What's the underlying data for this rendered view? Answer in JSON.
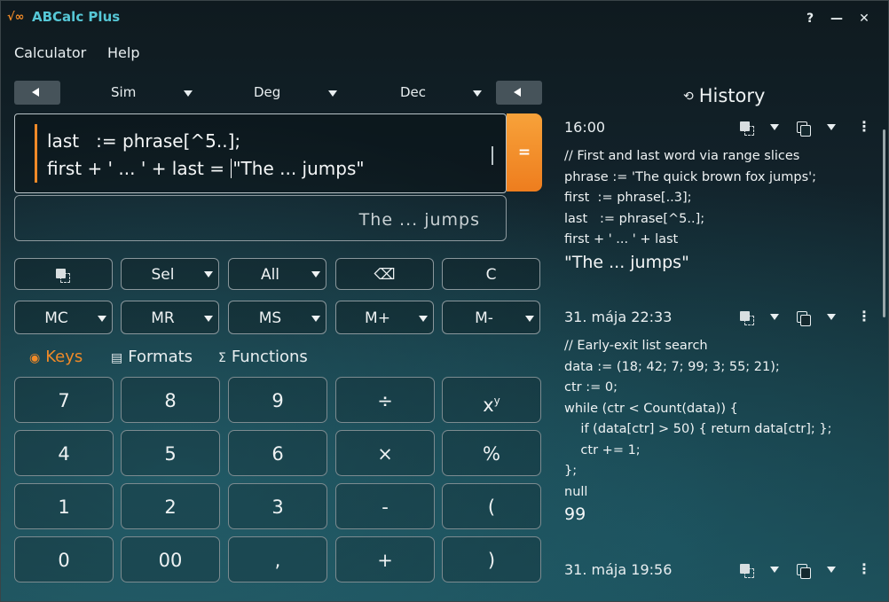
{
  "app": {
    "title": "ABCalc Plus",
    "icon_glyph": "√∞",
    "help_label": "?",
    "minimize_label": "—",
    "close_label": "✕"
  },
  "menu": {
    "items": [
      "Calculator",
      "Help"
    ]
  },
  "modes": {
    "angle_mode": "Sim",
    "unit_mode": "Deg",
    "base_mode": "Dec"
  },
  "expression": {
    "line1": "last   := phrase[^5..];",
    "line2_before": "first + ' ... ' + last = ",
    "line2_after": "\"The ... jumps\""
  },
  "equals_label": "=",
  "result": {
    "value": "The ... jumps"
  },
  "edit_row": {
    "sel_label": "Sel",
    "all_label": "All",
    "clear_label": "C",
    "backspace_glyph": "⌫"
  },
  "memory_row": {
    "labels": [
      "MC",
      "MR",
      "MS",
      "M+",
      "M-"
    ]
  },
  "tabs": {
    "keys_label": "Keys",
    "formats_label": "Formats",
    "functions_label": "Functions",
    "keys_icon": "◉",
    "formats_icon": "▤",
    "functions_icon": "Σ"
  },
  "keypad": {
    "rows": [
      [
        "7",
        "8",
        "9",
        "÷",
        "x"
      ],
      [
        "4",
        "5",
        "6",
        "×",
        "%"
      ],
      [
        "1",
        "2",
        "3",
        "-",
        "("
      ],
      [
        "0",
        "00",
        ",",
        "+",
        ")"
      ]
    ],
    "power_sup": "y"
  },
  "history": {
    "title": "History",
    "title_icon": "⟲",
    "entries": [
      {
        "time": "16:00",
        "code": "// First and last word via range slices\nphrase := 'The quick brown fox jumps';\nfirst  := phrase[..3];\nlast   := phrase[^5..];\nfirst + ' ... ' + last",
        "result": "\"The ... jumps\""
      },
      {
        "time": "31. mája 22:33",
        "code": "// Early-exit list search\ndata := (18; 42; 7; 99; 3; 55; 21);\nctr := 0;\nwhile (ctr < Count(data)) {\n    if (data[ctr] > 50) { return data[ctr]; };\n    ctr += 1;\n};\nnull",
        "result": "99"
      },
      {
        "time": "31. mája 19:56",
        "code": "",
        "result": ""
      }
    ]
  },
  "colors": {
    "accent": "#f08a28",
    "title_accent": "#56c7d6",
    "equals_bg": "#ee7d1e"
  }
}
